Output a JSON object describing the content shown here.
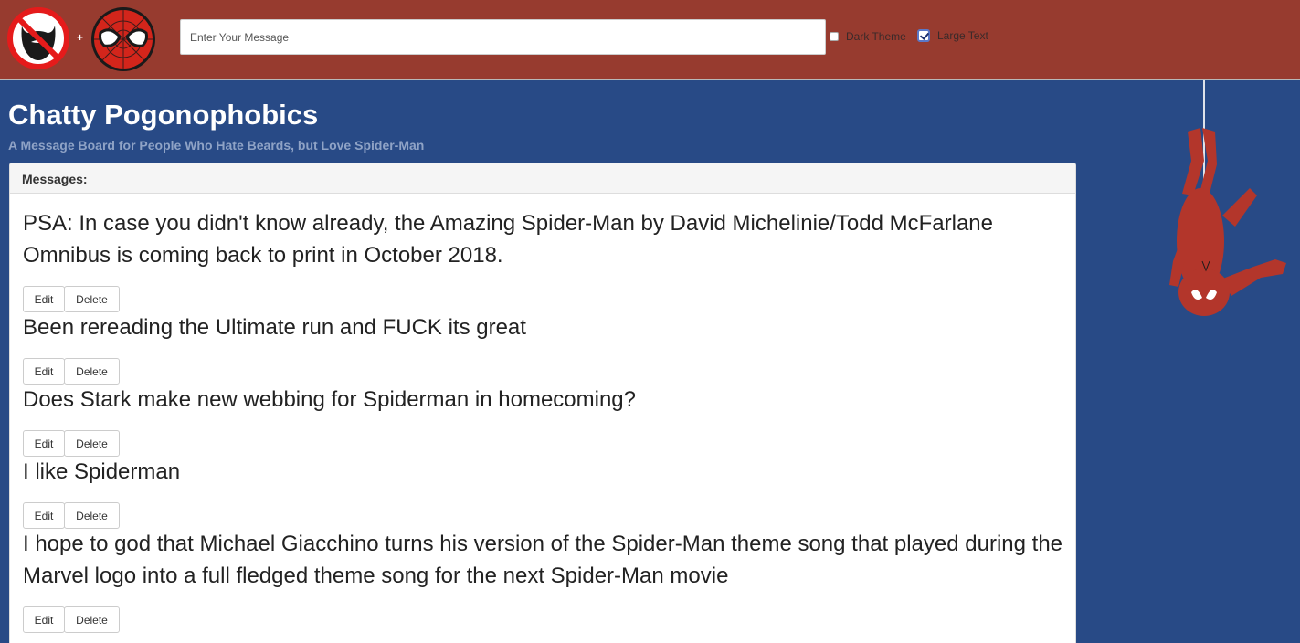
{
  "header": {
    "plus_sign": "+",
    "message_placeholder": "Enter Your Message",
    "dark_theme_label": "Dark Theme",
    "dark_theme_checked": false,
    "large_text_label": "Large Text",
    "large_text_checked": true
  },
  "page": {
    "title": "Chatty Pogonophobics",
    "subtitle": "A Message Board for People Who Hate Beards, but Love Spider-Man"
  },
  "panel": {
    "heading": "Messages:"
  },
  "messages": [
    {
      "text": "PSA: In case you didn't know already, the Amazing Spider-Man by David Michelinie/Todd McFarlane Omnibus is coming back to print in October 2018.",
      "edit_label": "Edit",
      "delete_label": "Delete"
    },
    {
      "text": "Been rereading the Ultimate run and FUCK its great",
      "edit_label": "Edit",
      "delete_label": "Delete"
    },
    {
      "text": "Does Stark make new webbing for Spiderman in homecoming?",
      "edit_label": "Edit",
      "delete_label": "Delete"
    },
    {
      "text": "I like Spiderman",
      "edit_label": "Edit",
      "delete_label": "Delete"
    },
    {
      "text": "I hope to god that Michael Giacchino turns his version of the Spider-Man theme song that played during the Marvel logo into a full fledged theme song for the next Spider-Man movie",
      "edit_label": "Edit",
      "delete_label": "Delete"
    }
  ],
  "colors": {
    "navbar": "#973b2f",
    "background": "#284a86",
    "spider_red": "#b3362b"
  },
  "icons": [
    "no-beard-logo-icon",
    "spider-man-mask-icon",
    "hanging-spider-man-icon"
  ]
}
